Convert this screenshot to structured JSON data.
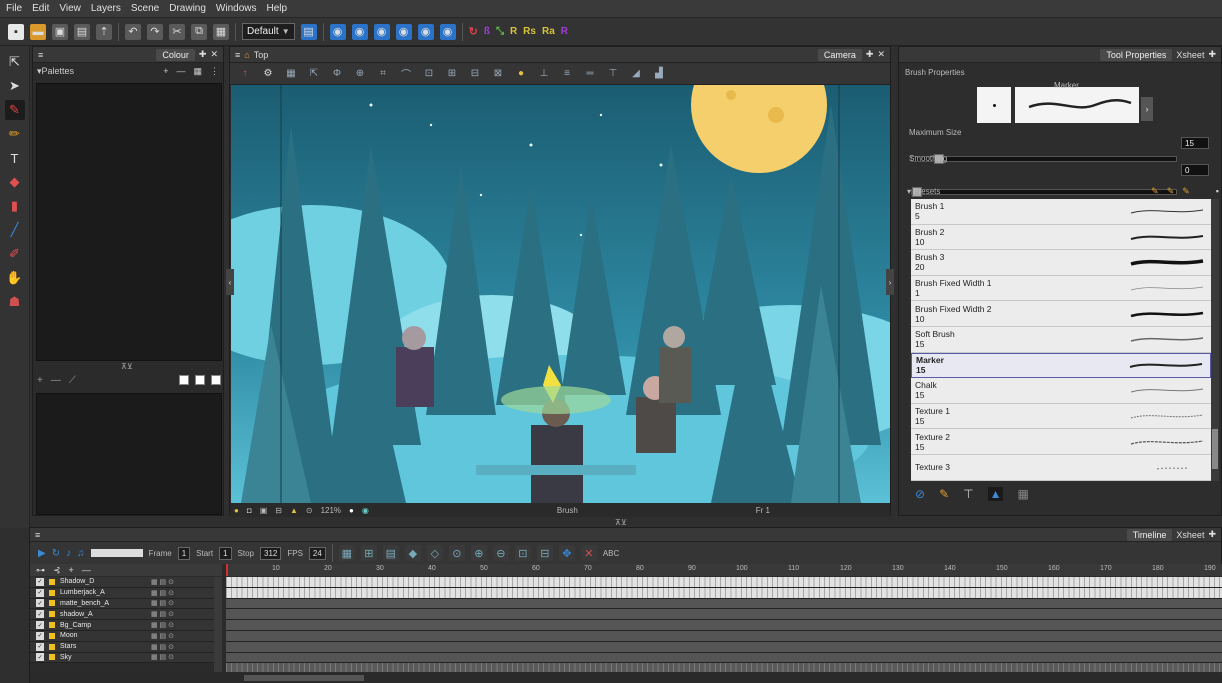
{
  "menu": [
    "File",
    "Edit",
    "View",
    "Layers",
    "Scene",
    "Drawing",
    "Windows",
    "Help"
  ],
  "toolbar": {
    "workspace": "Default",
    "tb_labels": [
      "R",
      "Rs",
      "Ra",
      "R"
    ]
  },
  "colour_panel": {
    "tab": "Colour",
    "palettes_label": "Palettes",
    "add": "+",
    "remove": "—",
    "hamburger": "≡"
  },
  "camera": {
    "tab": "Camera",
    "hamburger": "≡",
    "top_label": "Top",
    "zoom": "121%",
    "tool_name": "Brush",
    "frame": "Fr 1"
  },
  "tool_properties": {
    "tab": "Tool Properties",
    "tab2": "Xsheet",
    "brush_properties": "Brush Properties",
    "preview_label": "Marker",
    "max_size_label": "Maximum Size",
    "max_size": "15",
    "smoothing_label": "Smoothing",
    "smoothing": "0",
    "presets_label": "Presets",
    "presets": [
      {
        "name": "Brush 1",
        "size": "5"
      },
      {
        "name": "Brush 2",
        "size": "10"
      },
      {
        "name": "Brush 3",
        "size": "20"
      },
      {
        "name": "Brush Fixed Width 1",
        "size": "1"
      },
      {
        "name": "Brush Fixed Width 2",
        "size": "10"
      },
      {
        "name": "Soft Brush",
        "size": "15"
      },
      {
        "name": "Marker",
        "size": "15"
      },
      {
        "name": "Chalk",
        "size": "15"
      },
      {
        "name": "Texture 1",
        "size": "15"
      },
      {
        "name": "Texture 2",
        "size": "15"
      },
      {
        "name": "Texture 3",
        "size": ""
      }
    ],
    "selected_preset": "Marker"
  },
  "timeline": {
    "tab": "Timeline",
    "tab2": "Xsheet",
    "frame_label": "Frame",
    "frame": "1",
    "start_label": "Start",
    "start": "1",
    "stop_label": "Stop",
    "stop": "312",
    "fps_label": "FPS",
    "fps": "24",
    "abc_label": "ABC",
    "layers": [
      "Shadow_D",
      "Lumberjack_A",
      "matte_bench_A",
      "shadow_A",
      "Bg_Camp",
      "Moon",
      "Stars",
      "Sky"
    ],
    "ruler": [
      "10",
      "20",
      "30",
      "40",
      "50",
      "60",
      "70",
      "80",
      "90",
      "100",
      "110",
      "120",
      "130",
      "140",
      "150",
      "160",
      "170",
      "180",
      "190"
    ]
  }
}
